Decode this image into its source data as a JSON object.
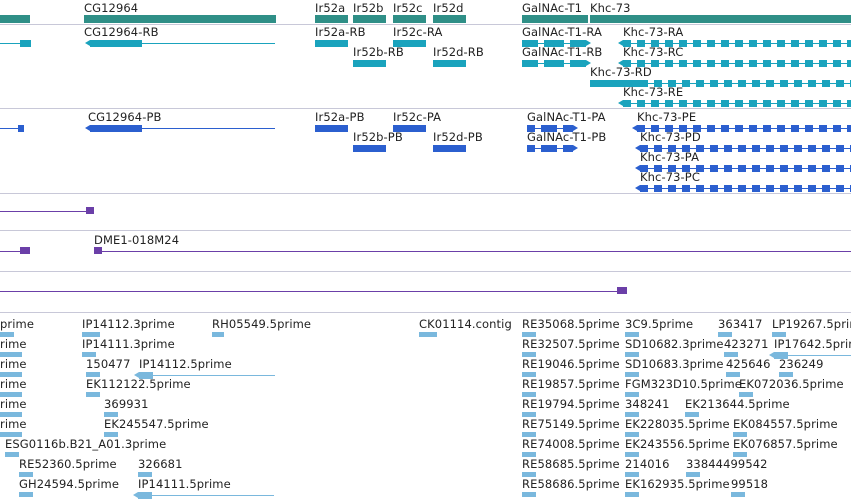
{
  "colors": {
    "gene": "#2f8f87",
    "mrna": "#1aa3bd",
    "cds": "#2b5fcf",
    "clone": "#6b3fa8",
    "est": "#7ab8dd",
    "separator": "#c8c8d8",
    "text": "#222222"
  },
  "tracks": {
    "genes": {
      "labels": [
        "CG12964",
        "Ir52a",
        "Ir52b",
        "Ir52c",
        "Ir52d",
        "GalNAc-T1",
        "Khc-73"
      ]
    },
    "transcripts": {
      "labels": [
        "CG12964-RB",
        "Ir52a-RB",
        "Ir52c-RA",
        "Ir52b-RB",
        "Ir52d-RB",
        "GalNAc-T1-RA",
        "GalNAc-T1-RB",
        "Khc-73-RA",
        "Khc-73-RC",
        "Khc-73-RD",
        "Khc-73-RE"
      ]
    },
    "proteins": {
      "labels": [
        "CG12964-PB",
        "Ir52a-PB",
        "Ir52c-PA",
        "Ir52b-PB",
        "Ir52d-PB",
        "GalNAc-T1-PA",
        "GalNAc-T1-PB",
        "Khc-73-PE",
        "Khc-73-PD",
        "Khc-73-PA",
        "Khc-73-PC"
      ]
    },
    "clones": {
      "labels": [
        "DME1-018M24"
      ]
    },
    "ests": {
      "labels": [
        "prime",
        "IP14112.3prime",
        "RH05549.5prime",
        "CK01114.contig",
        "RE35068.5prime",
        "3C9.5prime",
        "363417",
        "LP19267.5prime",
        "rime",
        "IP14111.3prime",
        "RE32507.5prime",
        "SD10682.3prime",
        "423271",
        "IP17642.5prime",
        "rime",
        "150477",
        "IP14112.5prime",
        "RE19046.5prime",
        "SD10683.3prime",
        "425646",
        "236249",
        "rime",
        "EK112122.5prime",
        "RE19857.5prime",
        "FGM323D10.5prime",
        "EK072036.5prime",
        "rime",
        "369931",
        "RE19794.5prime",
        "348241",
        "EK213644.5prime",
        "rime",
        "EK245547.5prime",
        "RE75149.5prime",
        "EK228035.5prime",
        "EK084557.5prime",
        "ESG0116b.B21_A01.3prime",
        "RE74008.5prime",
        "EK243556.5prime",
        "EK076857.5prime",
        "RE52360.5prime",
        "326681",
        "RE58685.5prime",
        "214016",
        "33844499542",
        "GH24594.5prime",
        "IP14111.5prime",
        "RE58686.5prime",
        "EK162935.5prime",
        "99518"
      ]
    }
  }
}
